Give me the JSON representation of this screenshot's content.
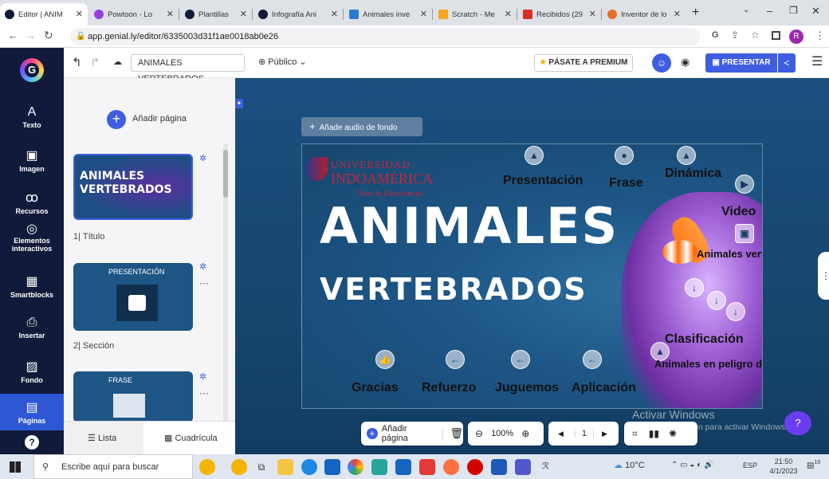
{
  "browser": {
    "tabs": [
      {
        "label": "Editor | ANIM",
        "color": "#111a3a",
        "active": true
      },
      {
        "label": "Powtoon - Lo",
        "color": "#9a3de0"
      },
      {
        "label": "Plantillas",
        "color": "#111a3a"
      },
      {
        "label": "Infografía Ani",
        "color": "#111a3a"
      },
      {
        "label": "Animales inve",
        "color": "#2b7bd4"
      },
      {
        "label": "Scratch - Me",
        "color": "#f7a721"
      },
      {
        "label": "Recibidos (29",
        "color": "#d93025"
      },
      {
        "label": "Inventor de lo",
        "color": "#e86e2b"
      }
    ],
    "new_tab": "+",
    "url": "app.genial.ly/editor/6335003d31f1ae0018ab0e26",
    "profile_initial": "R"
  },
  "header": {
    "project_title": "ANIMALES VERTEBRADOS",
    "visibility": "Público",
    "premium_label": "PÁSATE A PREMIUM",
    "present_label": "PRESENTAR"
  },
  "leftnav": {
    "items": [
      {
        "label": "Texto",
        "icon": "A"
      },
      {
        "label": "Imagen",
        "icon": "🖼"
      },
      {
        "label": "Recursos",
        "icon": "⚘"
      },
      {
        "label": "Elementos interactivos",
        "icon": "☝"
      },
      {
        "label": "Smartblocks",
        "icon": "▦"
      },
      {
        "label": "Insertar",
        "icon": "⎙"
      },
      {
        "label": "Fondo",
        "icon": "▧"
      },
      {
        "label": "Páginas",
        "icon": "▤"
      }
    ],
    "help": "?"
  },
  "pages_panel": {
    "add_page": "Añadir página",
    "pages": [
      {
        "number": "1",
        "name": "Título",
        "thumb_title": "ANIMALES VERTEBRADOS"
      },
      {
        "number": "2",
        "name": "Sección",
        "thumb_title": "PRESENTACIÓN"
      },
      {
        "number": "3",
        "name": "",
        "thumb_title": "FRASE"
      }
    ],
    "list_tab": "Lista",
    "grid_tab": "Cuadrícula"
  },
  "canvas": {
    "audio_button": "Añade audio de fondo",
    "slide": {
      "logo_line1": "UNIVERSIDAD",
      "logo_line2": "INDOAMÉRICA",
      "logo_line3": "Vive la Excelencia",
      "title_1": "ANIMALES",
      "title_2": "VERTEBRADOS",
      "labels": {
        "presentacion": "Presentación",
        "frase": "Frase",
        "dinamica": "Dinámica",
        "video": "Video",
        "animales_vertebrados": "Animales vertebrados",
        "clasificacion": "Clasificación",
        "peligro": "Animales en peligro de extinción",
        "gracias": "Gracias",
        "refuerzo": "Refuerzo",
        "juguemos": "Juguemos",
        "aplicacion": "Aplicación"
      }
    },
    "toolbar": {
      "add_page": "Añadir página",
      "zoom": "100%",
      "page_number": "1"
    },
    "watermark_1": "Activar Windows",
    "watermark_2": "Ve a Configuración para activar Windows."
  },
  "taskbar": {
    "search_placeholder": "Escribe aquí para buscar",
    "weather": "10°C",
    "lang": "ESP",
    "time": "21:50",
    "date": "4/1/2023",
    "notifications": "10"
  }
}
